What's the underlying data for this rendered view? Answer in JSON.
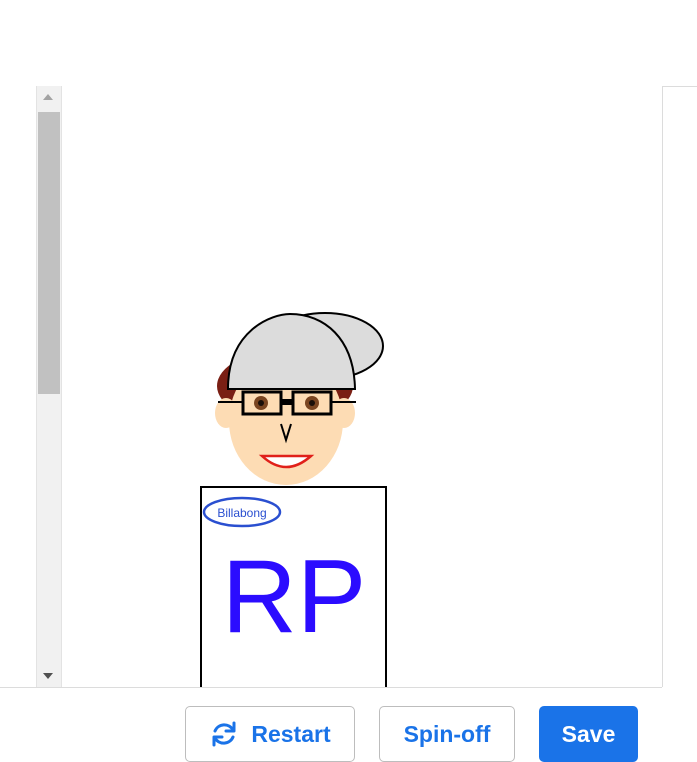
{
  "toolbar": {
    "restart_label": "Restart",
    "spinoff_label": "Spin-off",
    "save_label": "Save"
  },
  "drawing": {
    "cap_brand_text": "Billabong",
    "shirt_text": "RP",
    "colors": {
      "cap": "#dcdcdc",
      "skin": "#fddcb4",
      "hair": "#7a1f14",
      "eye": "#7a4520",
      "mouth": "#e0201a",
      "shirt_text": "#2b0cff",
      "logo": "#2a4fd0"
    }
  },
  "icons": {
    "restart": "restart-icon"
  },
  "colors": {
    "accent": "#1a73e8"
  }
}
